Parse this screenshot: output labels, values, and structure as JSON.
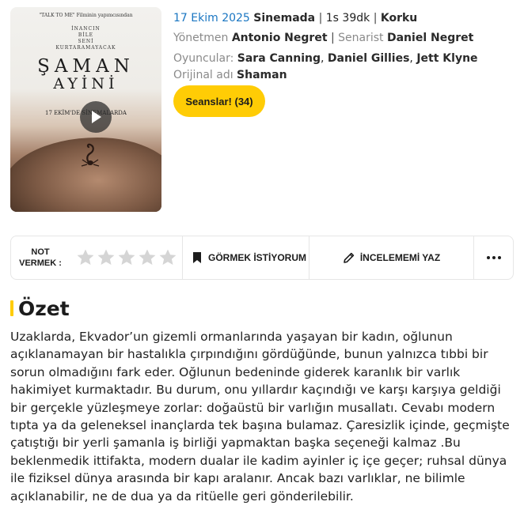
{
  "poster": {
    "tagline": "\"TALK TO ME\" Filminin yapımcısından",
    "subtitle": "İNANCIN\nBİLE\nSENİ\nKURTARAMAYACAK",
    "title_line1": "ŞAMAN",
    "title_line2": "AYİNİ",
    "release_text": "17 EKİM'DE SİNEMALARDA"
  },
  "movie": {
    "release_date": "17 Ekim 2025",
    "status": "Sinemada",
    "duration": "1s 39dk",
    "genre": "Korku",
    "director_label": "Yönetmen",
    "director": "Antonio Negret",
    "writer_label": "Senarist",
    "writer": "Daniel Negret",
    "cast_label": "Oyuncular:",
    "cast": [
      "Sara Canning",
      "Daniel Gillies",
      "Jett Klyne"
    ],
    "original_title_label": "Orijinal adı",
    "original_title": "Shaman"
  },
  "sessions_button": "Seanslar! (34)",
  "actions": {
    "rate_label": "NOT VERMEK :",
    "rating": 0,
    "rating_max": 5,
    "watchlist_label": "GÖRMEK İSTİYORUM",
    "review_label": "İNCELEMEMİ YAZ"
  },
  "summary": {
    "heading": "Özet",
    "text": "Uzaklarda, Ekvador’un gizemli ormanlarında yaşayan bir kadın, oğlunun açıklanamayan bir hastalıkla çırpındığını gördüğünde, bunun yalnızca tıbbi bir sorun olmadığını fark eder. Oğlunun bedeninde giderek karanlık bir varlık hakimiyet kurmaktadır. Bu durum, onu yıllardır kaçındığı ve karşı karşıya geldiği bir gerçekle yüzleşmeye zorlar: doğaüstü bir varlığın musallatı. Cevabı modern tıpta ya da geleneksel inançlarda tek başına bulamaz. Çaresizlik içinde, geçmişte çatıştığı bir yerli şamanla iş birliği yapmaktan başka seçeneği kalmaz .Bu beklenmedik ittifakta, modern dualar ile kadim ayinler iç içe geçer; ruhsal dünya ile fiziksel dünya arasında bir kapı aralanır. Ancak bazı varlıklar, ne bilimle açıklanabilir, ne de dua ya da ritüelle geri gönderilebilir."
  },
  "colors": {
    "accent": "#ffcc05",
    "link_blue": "#1a76c2",
    "star_empty": "#d5d5d5"
  },
  "icons": [
    "play-icon",
    "star-icon",
    "bookmark-icon",
    "pencil-icon",
    "more-dots-icon"
  ]
}
